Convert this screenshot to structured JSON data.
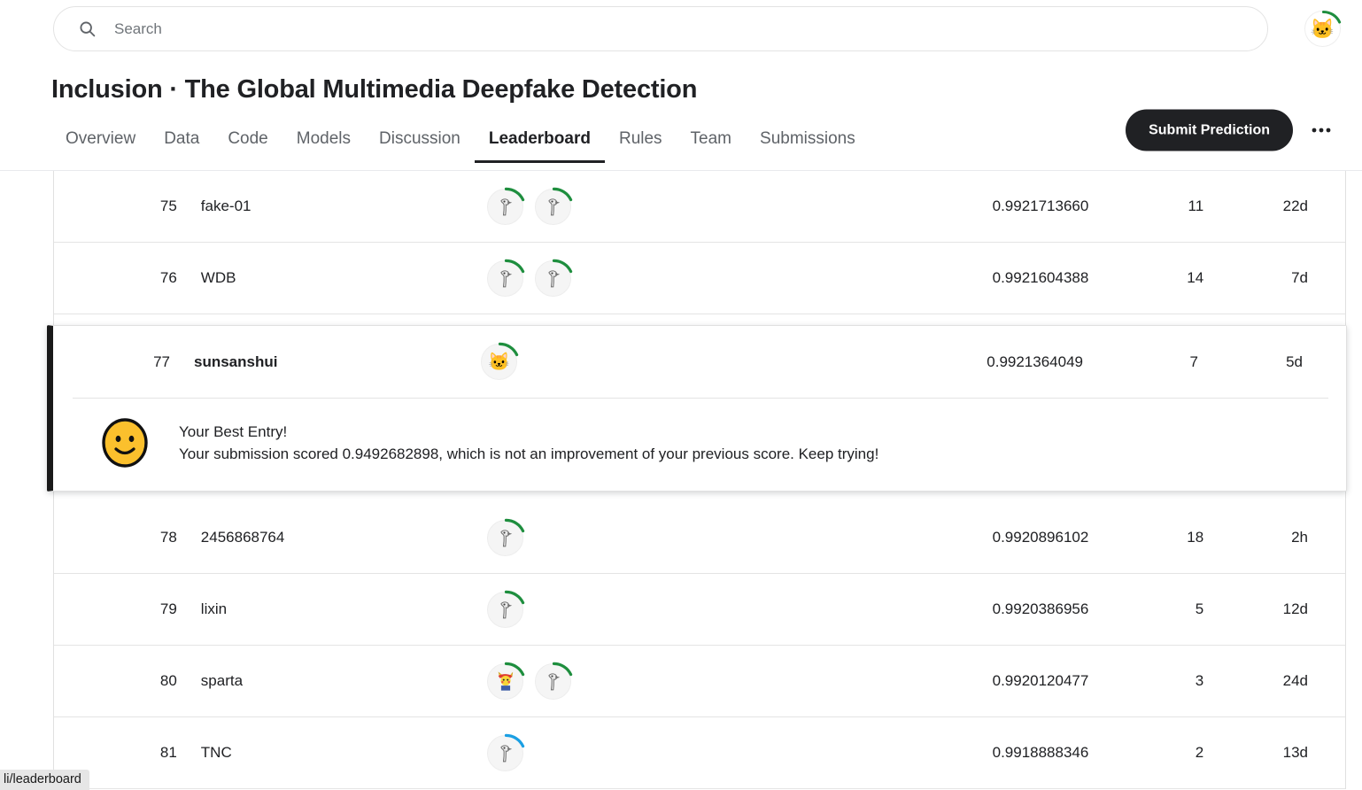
{
  "search": {
    "placeholder": "Search",
    "value": "",
    "icon": "search-icon"
  },
  "account": {
    "avatar_icon": "cat-avatar",
    "avatar_glyph": "🐱",
    "ring_color": "#1e8e3e"
  },
  "header": {
    "title": "Inclusion · The Global Multimedia Deepfake Detection",
    "submit_label": "Submit Prediction",
    "more_label": "•••"
  },
  "tabs": [
    {
      "label": "Overview",
      "active": false
    },
    {
      "label": "Data",
      "active": false
    },
    {
      "label": "Code",
      "active": false
    },
    {
      "label": "Models",
      "active": false
    },
    {
      "label": "Discussion",
      "active": false
    },
    {
      "label": "Leaderboard",
      "active": true
    },
    {
      "label": "Rules",
      "active": false
    },
    {
      "label": "Team",
      "active": false
    },
    {
      "label": "Submissions",
      "active": false
    }
  ],
  "leaderboard": {
    "partial_row": {
      "avatar_rings": [
        "#7b2ff7",
        "#7b2ff7",
        "#7b2ff7",
        "#efefef",
        "#111111"
      ]
    },
    "rows": [
      {
        "rank": "75",
        "team": "fake-01",
        "avatars": [
          {
            "type": "bird",
            "ring": "#1e8e3e"
          },
          {
            "type": "bird",
            "ring": "#1e8e3e"
          }
        ],
        "score": "0.9921713660",
        "entries": "11",
        "last": "22d",
        "highlight": false
      },
      {
        "rank": "76",
        "team": "WDB",
        "avatars": [
          {
            "type": "bird",
            "ring": "#1e8e3e"
          },
          {
            "type": "bird",
            "ring": "#1e8e3e"
          }
        ],
        "score": "0.9921604388",
        "entries": "14",
        "last": "7d",
        "highlight": false
      },
      {
        "rank": "78",
        "team": "2456868764",
        "avatars": [
          {
            "type": "bird",
            "ring": "#1e8e3e"
          }
        ],
        "score": "0.9920896102",
        "entries": "18",
        "last": "2h",
        "highlight": false
      },
      {
        "rank": "79",
        "team": "lixin",
        "avatars": [
          {
            "type": "bird",
            "ring": "#1e8e3e"
          }
        ],
        "score": "0.9920386956",
        "entries": "5",
        "last": "12d",
        "highlight": false
      },
      {
        "rank": "80",
        "team": "sparta",
        "avatars": [
          {
            "type": "pikachu",
            "ring": "#1e8e3e"
          },
          {
            "type": "bird",
            "ring": "#1e8e3e"
          }
        ],
        "score": "0.9920120477",
        "entries": "3",
        "last": "24d",
        "highlight": false
      },
      {
        "rank": "81",
        "team": "TNC",
        "avatars": [
          {
            "type": "bird",
            "ring": "#1a9fe3"
          }
        ],
        "score": "0.9918888346",
        "entries": "2",
        "last": "13d",
        "highlight": false
      }
    ],
    "your_entry": {
      "rank": "77",
      "team": "sunsanshui",
      "avatars": [
        {
          "type": "cat",
          "ring": "#1e8e3e"
        }
      ],
      "score": "0.9921364049",
      "entries": "7",
      "last": "5d",
      "note_title": "Your Best Entry!",
      "note_body": "Your submission scored 0.9492682898, which is not an improvement of your previous score. Keep trying!",
      "smiley_color": "#fbc02d",
      "accent_color": "#1a1a1a"
    }
  },
  "status_bar": {
    "url": "li/leaderboard"
  }
}
